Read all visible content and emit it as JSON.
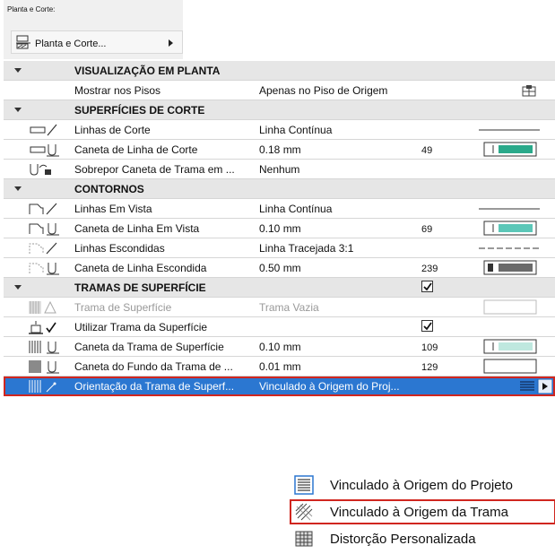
{
  "header": {
    "caption": "Planta e Corte:",
    "view_button_label": "Planta e Corte..."
  },
  "sections": {
    "s1": "VISUALIZAÇÃO EM PLANTA",
    "s2": "SUPERFÍCIES DE CORTE",
    "s3": "CONTORNOS",
    "s4": "TRAMAS DE SUPERFÍCIE"
  },
  "rows": {
    "show_floors": {
      "name": "Mostrar nos Pisos",
      "value": "Apenas no Piso de Origem"
    },
    "cut_lines": {
      "name": "Linhas de Corte",
      "value": "Linha Contínua"
    },
    "cut_line_pen": {
      "name": "Caneta de Linha de Corte",
      "value": "0.18 mm",
      "number": "49",
      "swatch": "#2aa98a"
    },
    "override_pen": {
      "name": "Sobrepor Caneta de Trama em ...",
      "value": "Nenhum"
    },
    "view_lines": {
      "name": "Linhas Em Vista",
      "value": "Linha Contínua"
    },
    "view_line_pen": {
      "name": "Caneta de Linha Em Vista",
      "value": "0.10 mm",
      "number": "69",
      "swatch": "#5cc7b8"
    },
    "hidden_lines": {
      "name": "Linhas Escondidas",
      "value": "Linha Tracejada 3:1"
    },
    "hidden_line_pen": {
      "name": "Caneta de Linha Escondida",
      "value": "0.50 mm",
      "number": "239",
      "swatch": "#6b6b6b"
    },
    "surface_fill": {
      "name": "Trama de Superfície",
      "value": "Trama Vazia"
    },
    "use_surface_fill": {
      "name": "Utilizar Trama da Superfície"
    },
    "fill_pen": {
      "name": "Caneta da Trama de Superfície",
      "value": "0.10 mm",
      "number": "109",
      "swatch": "#bfe8df"
    },
    "fill_bg_pen": {
      "name": "Caneta do Fundo da Trama de ...",
      "value": "0.01 mm",
      "number": "129",
      "swatch": "#ffffff"
    },
    "fill_orientation": {
      "name": "Orientação da Trama de Superf...",
      "value": "Vinculado à Origem do Proj..."
    }
  },
  "checkboxes": {
    "section_fills_checked": true,
    "use_surface_fill_checked": true
  },
  "menu": {
    "items": [
      "Vinculado à Origem do Projeto",
      "Vinculado à Origem da Trama",
      "Distorção Personalizada"
    ],
    "highlighted_index": 1
  },
  "colors": {
    "selection": "#2b77d1",
    "highlight_outline": "#d0261f",
    "section_bg": "#e6e6e6"
  }
}
